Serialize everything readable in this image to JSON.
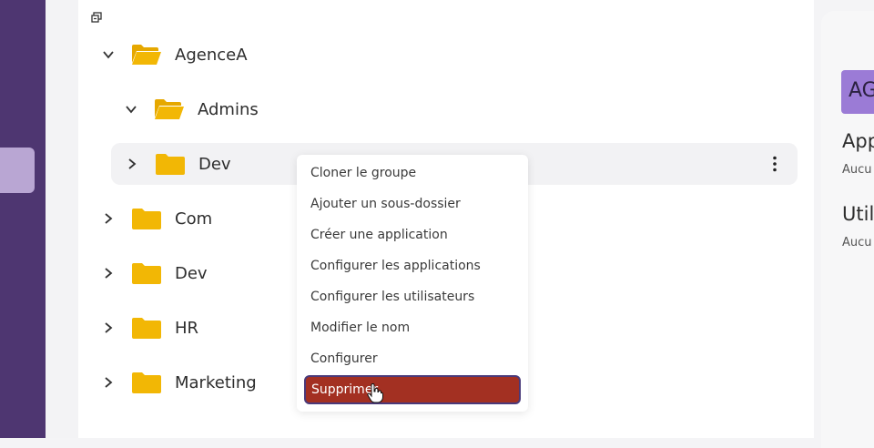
{
  "tree": {
    "rows": [
      {
        "label": "AgenceA",
        "expanded": true,
        "icon": "folder-open-icon"
      },
      {
        "label": "Admins",
        "expanded": true,
        "icon": "folder-open-icon"
      },
      {
        "label": "Dev",
        "expanded": false,
        "icon": "folder-icon"
      },
      {
        "label": "Com",
        "expanded": false,
        "icon": "folder-icon"
      },
      {
        "label": "Dev",
        "expanded": false,
        "icon": "folder-icon"
      },
      {
        "label": "HR",
        "expanded": false,
        "icon": "folder-icon"
      },
      {
        "label": "Marketing",
        "expanded": false,
        "icon": "folder-icon"
      }
    ]
  },
  "context_menu": {
    "items": [
      "Cloner le groupe",
      "Ajouter un sous-dossier",
      "Créer une application",
      "Configurer les applications",
      "Configurer les utilisateurs",
      "Modifier le nom",
      "Configurer"
    ],
    "danger_item": "Supprimer"
  },
  "right_panel": {
    "badge": "AG",
    "sections": [
      {
        "title": "App",
        "subtitle": "Aucu"
      },
      {
        "title": "Util",
        "subtitle": "Aucu"
      }
    ]
  },
  "colors": {
    "sidebar": "#4e3671",
    "folder": "#f2b705",
    "danger": "#a33022",
    "badge": "#9b7bd6"
  }
}
